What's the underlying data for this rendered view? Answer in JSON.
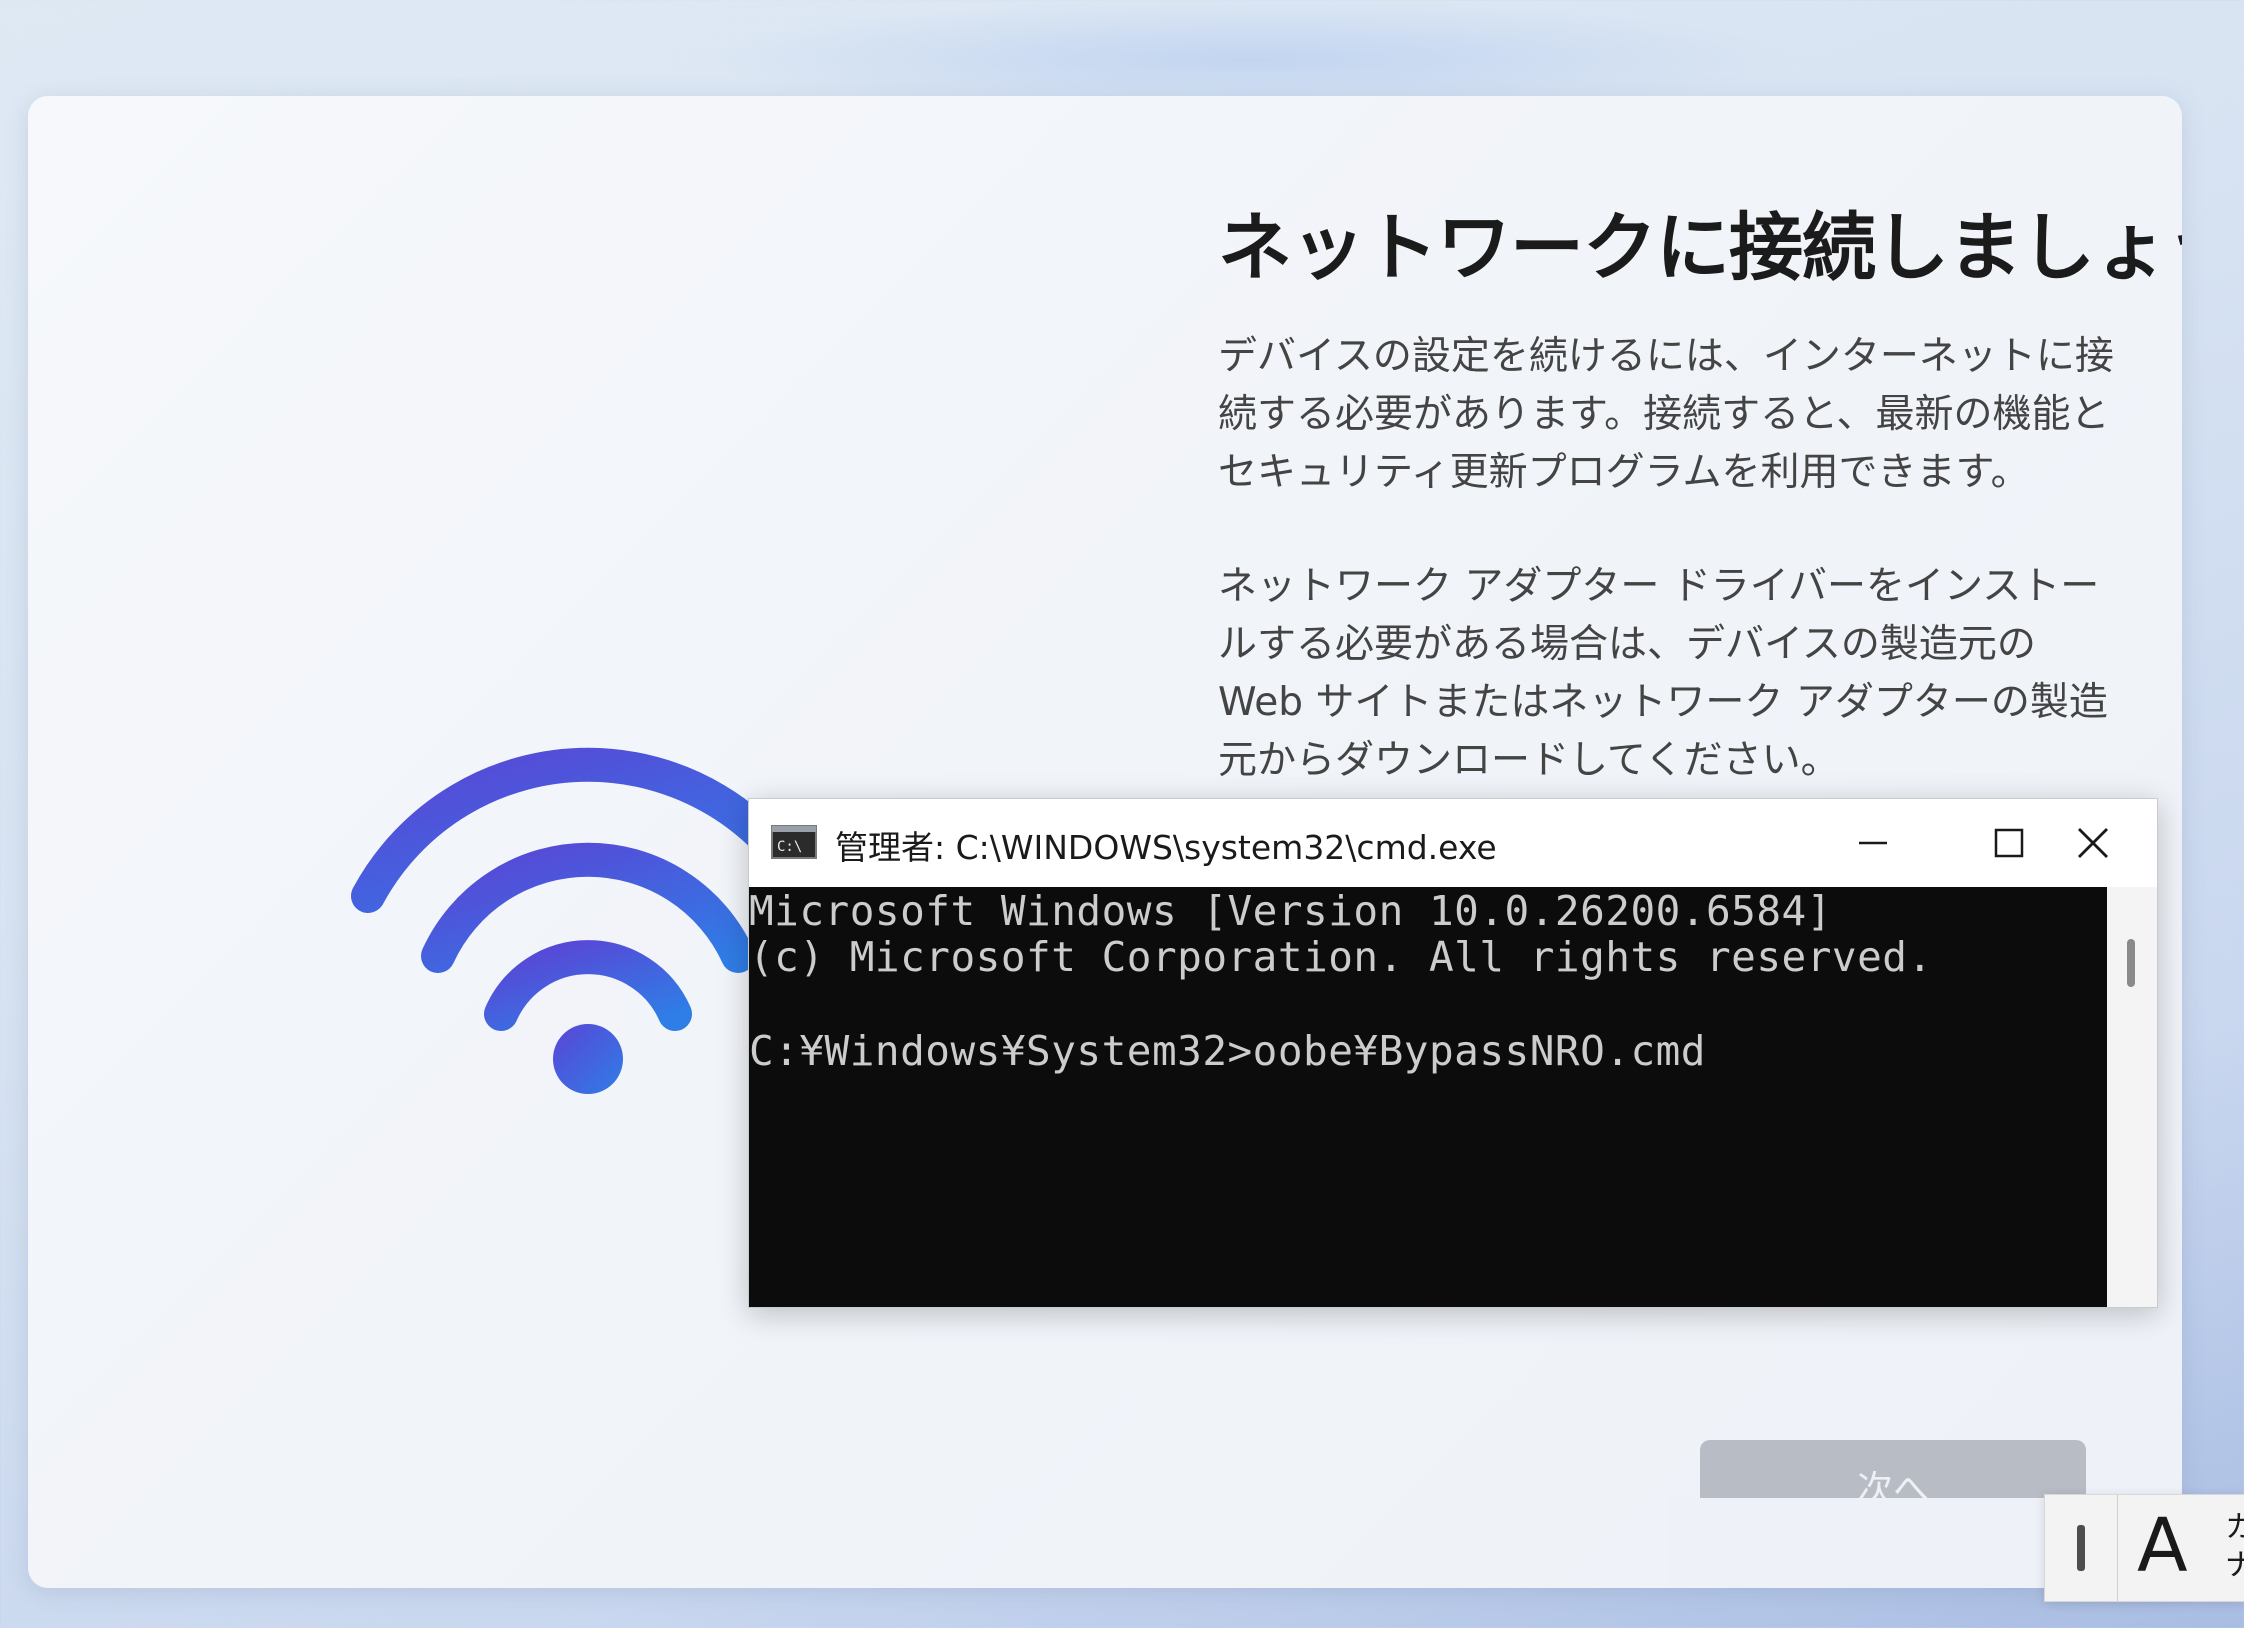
{
  "oobe": {
    "title": "ネットワークに接続しましょう",
    "description_1": "デバイスの設定を続けるには、インターネットに接続する必要があります。接続すると、最新の機能とセキュリティ更新プログラムを利用できます。",
    "description_2": "ネットワーク アダプター ドライバーをインストールする必要がある場合は、デバイスの製造元の Web サイトまたはネットワーク アダプターの製造元からダウンロードしてください。",
    "next_label": "次へ",
    "icon": "wifi-icon",
    "accent_color": "#3b6fe0"
  },
  "cmd": {
    "title": "管理者: C:\\WINDOWS\\system32\\cmd.exe",
    "icon": "cmd-icon",
    "lines": [
      "Microsoft Windows [Version 10.0.26200.6584]",
      "(c) Microsoft Corporation. All rights reserved.",
      "C:¥Windows¥System32>oobe¥BypassNRO.cmd"
    ],
    "buttons": {
      "minimize": "minimize-icon",
      "maximize": "maximize-icon",
      "close": "close-icon"
    }
  },
  "ime": {
    "mode_label": "A",
    "kana_label": "カナ"
  }
}
